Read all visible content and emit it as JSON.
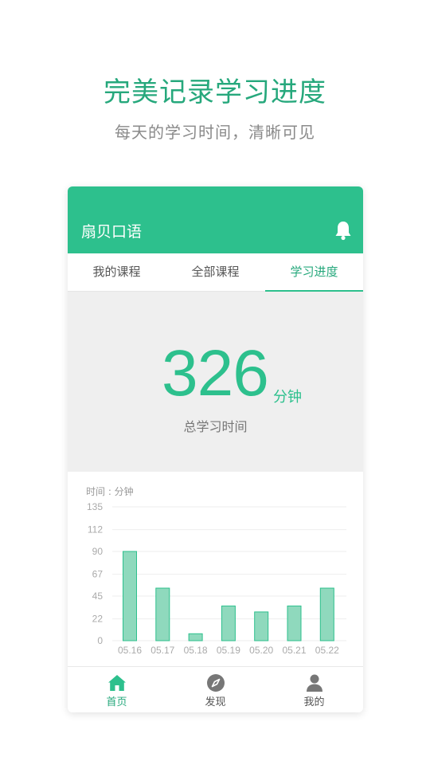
{
  "promo": {
    "title": "完美记录学习进度",
    "subtitle": "每天的学习时间，清晰可见"
  },
  "app": {
    "title": "扇贝口语",
    "notification_icon": "bell-icon"
  },
  "tabs": [
    {
      "label": "我的课程",
      "active": false
    },
    {
      "label": "全部课程",
      "active": false
    },
    {
      "label": "学习进度",
      "active": true
    }
  ],
  "stats": {
    "total_value": "326",
    "total_unit": "分钟",
    "total_label": "总学习时间"
  },
  "chart_data": {
    "type": "bar",
    "ylabel": "时间 : 分钟",
    "yticks": [
      0,
      22,
      45,
      67,
      90,
      112,
      135
    ],
    "ylim": [
      0,
      135
    ],
    "categories": [
      "05.16",
      "05.17",
      "05.18",
      "05.19",
      "05.20",
      "05.21",
      "05.22"
    ],
    "values": [
      90,
      53,
      7,
      35,
      29,
      35,
      53
    ],
    "bar_color": "#8fd9bd",
    "bar_stroke": "#2dc08d"
  },
  "bottom_nav": [
    {
      "label": "首页",
      "icon": "home-icon",
      "active": true
    },
    {
      "label": "发现",
      "icon": "compass-icon",
      "active": false
    },
    {
      "label": "我的",
      "icon": "user-icon",
      "active": false
    }
  ],
  "colors": {
    "accent": "#2dc08d",
    "accent_text": "#26a87c"
  }
}
